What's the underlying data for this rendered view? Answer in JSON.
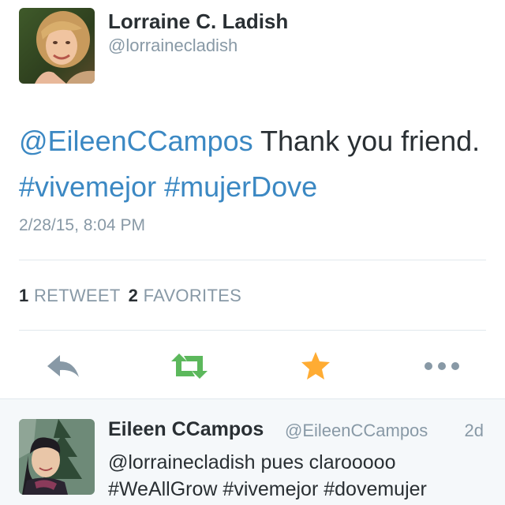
{
  "tweet": {
    "author_name": "Lorraine C. Ladish",
    "author_handle": "@lorrainecladish",
    "text": {
      "mention": "@EileenCCampos",
      "body": " Thank you friend. ",
      "hashtag1": "#vivemejor",
      "space": " ",
      "hashtag2": "#mujerDove"
    },
    "timestamp": "2/28/15, 8:04 PM",
    "stats": {
      "retweet_count": "1",
      "retweet_label": "RETWEET",
      "favorite_count": "2",
      "favorite_label": "FAVORITES"
    },
    "actions": {
      "reply_icon": "reply-arrow-icon",
      "retweet_icon": "retweet-icon",
      "favorite_icon": "star-icon",
      "more_icon": "more-dots-icon"
    }
  },
  "reply": {
    "author_name": "Eileen CCampos",
    "author_handle": "@EileenCCampos",
    "time": "2d",
    "text_line1": "@lorrainecladish pues clarooooo",
    "text_line2": "#WeAllGrow #vivemejor #dovemujer"
  },
  "colors": {
    "link": "#3b88c3",
    "secondary_text": "#8899a6",
    "primary_text": "#292f33",
    "retweet_green": "#5cb85c",
    "favorite_gold": "#ffac33",
    "action_gray": "#8899a6"
  }
}
